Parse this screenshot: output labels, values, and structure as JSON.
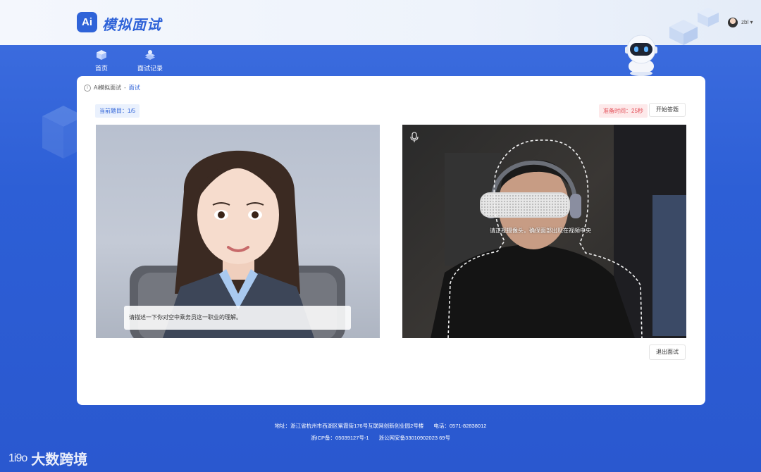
{
  "header": {
    "logo_badge": "Ai",
    "app_title": "模拟面试",
    "username": "zbl"
  },
  "nav": {
    "items": [
      {
        "label": "首页",
        "icon": "cube-icon"
      },
      {
        "label": "面试记录",
        "icon": "record-icon"
      }
    ]
  },
  "breadcrumb": {
    "parent": "Ai模拟面试",
    "separator": " - ",
    "current": "面试"
  },
  "interview": {
    "question_progress": "当前题目：1/5",
    "prep_time": "准备时间：25秒",
    "start_button": "开始答题",
    "exit_button": "退出面试",
    "question_subtitle": "请描述一下你对空中乘务员这一职业的理解。",
    "camera_hint": "请正视摄像头，确保面部出现在视频中央"
  },
  "footer": {
    "address": "地址：浙江省杭州市西湖区紫霞街176号互联网创新创业园2号楼",
    "phone": "电话：0571-82838012",
    "icp": "浙ICP备：05039127号-1",
    "police": "浙公网安备33010902023 69号"
  },
  "watermark": {
    "logo": "1i9o",
    "text": "大数跨境"
  },
  "colors": {
    "brand": "#2f63d8",
    "background": "#2d5fd6",
    "prep_red": "#e24b54"
  }
}
